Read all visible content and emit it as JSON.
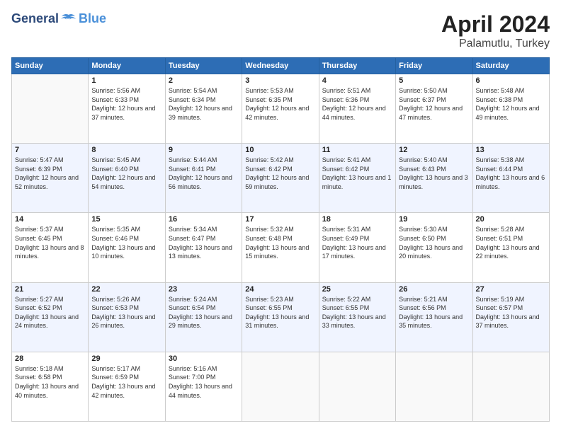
{
  "logo": {
    "general": "General",
    "blue": "Blue"
  },
  "title": {
    "month_year": "April 2024",
    "location": "Palamutlu, Turkey"
  },
  "weekdays": [
    "Sunday",
    "Monday",
    "Tuesday",
    "Wednesday",
    "Thursday",
    "Friday",
    "Saturday"
  ],
  "weeks": [
    [
      {
        "day": "",
        "sunrise": "",
        "sunset": "",
        "daylight": ""
      },
      {
        "day": "1",
        "sunrise": "Sunrise: 5:56 AM",
        "sunset": "Sunset: 6:33 PM",
        "daylight": "Daylight: 12 hours and 37 minutes."
      },
      {
        "day": "2",
        "sunrise": "Sunrise: 5:54 AM",
        "sunset": "Sunset: 6:34 PM",
        "daylight": "Daylight: 12 hours and 39 minutes."
      },
      {
        "day": "3",
        "sunrise": "Sunrise: 5:53 AM",
        "sunset": "Sunset: 6:35 PM",
        "daylight": "Daylight: 12 hours and 42 minutes."
      },
      {
        "day": "4",
        "sunrise": "Sunrise: 5:51 AM",
        "sunset": "Sunset: 6:36 PM",
        "daylight": "Daylight: 12 hours and 44 minutes."
      },
      {
        "day": "5",
        "sunrise": "Sunrise: 5:50 AM",
        "sunset": "Sunset: 6:37 PM",
        "daylight": "Daylight: 12 hours and 47 minutes."
      },
      {
        "day": "6",
        "sunrise": "Sunrise: 5:48 AM",
        "sunset": "Sunset: 6:38 PM",
        "daylight": "Daylight: 12 hours and 49 minutes."
      }
    ],
    [
      {
        "day": "7",
        "sunrise": "Sunrise: 5:47 AM",
        "sunset": "Sunset: 6:39 PM",
        "daylight": "Daylight: 12 hours and 52 minutes."
      },
      {
        "day": "8",
        "sunrise": "Sunrise: 5:45 AM",
        "sunset": "Sunset: 6:40 PM",
        "daylight": "Daylight: 12 hours and 54 minutes."
      },
      {
        "day": "9",
        "sunrise": "Sunrise: 5:44 AM",
        "sunset": "Sunset: 6:41 PM",
        "daylight": "Daylight: 12 hours and 56 minutes."
      },
      {
        "day": "10",
        "sunrise": "Sunrise: 5:42 AM",
        "sunset": "Sunset: 6:42 PM",
        "daylight": "Daylight: 12 hours and 59 minutes."
      },
      {
        "day": "11",
        "sunrise": "Sunrise: 5:41 AM",
        "sunset": "Sunset: 6:42 PM",
        "daylight": "Daylight: 13 hours and 1 minute."
      },
      {
        "day": "12",
        "sunrise": "Sunrise: 5:40 AM",
        "sunset": "Sunset: 6:43 PM",
        "daylight": "Daylight: 13 hours and 3 minutes."
      },
      {
        "day": "13",
        "sunrise": "Sunrise: 5:38 AM",
        "sunset": "Sunset: 6:44 PM",
        "daylight": "Daylight: 13 hours and 6 minutes."
      }
    ],
    [
      {
        "day": "14",
        "sunrise": "Sunrise: 5:37 AM",
        "sunset": "Sunset: 6:45 PM",
        "daylight": "Daylight: 13 hours and 8 minutes."
      },
      {
        "day": "15",
        "sunrise": "Sunrise: 5:35 AM",
        "sunset": "Sunset: 6:46 PM",
        "daylight": "Daylight: 13 hours and 10 minutes."
      },
      {
        "day": "16",
        "sunrise": "Sunrise: 5:34 AM",
        "sunset": "Sunset: 6:47 PM",
        "daylight": "Daylight: 13 hours and 13 minutes."
      },
      {
        "day": "17",
        "sunrise": "Sunrise: 5:32 AM",
        "sunset": "Sunset: 6:48 PM",
        "daylight": "Daylight: 13 hours and 15 minutes."
      },
      {
        "day": "18",
        "sunrise": "Sunrise: 5:31 AM",
        "sunset": "Sunset: 6:49 PM",
        "daylight": "Daylight: 13 hours and 17 minutes."
      },
      {
        "day": "19",
        "sunrise": "Sunrise: 5:30 AM",
        "sunset": "Sunset: 6:50 PM",
        "daylight": "Daylight: 13 hours and 20 minutes."
      },
      {
        "day": "20",
        "sunrise": "Sunrise: 5:28 AM",
        "sunset": "Sunset: 6:51 PM",
        "daylight": "Daylight: 13 hours and 22 minutes."
      }
    ],
    [
      {
        "day": "21",
        "sunrise": "Sunrise: 5:27 AM",
        "sunset": "Sunset: 6:52 PM",
        "daylight": "Daylight: 13 hours and 24 minutes."
      },
      {
        "day": "22",
        "sunrise": "Sunrise: 5:26 AM",
        "sunset": "Sunset: 6:53 PM",
        "daylight": "Daylight: 13 hours and 26 minutes."
      },
      {
        "day": "23",
        "sunrise": "Sunrise: 5:24 AM",
        "sunset": "Sunset: 6:54 PM",
        "daylight": "Daylight: 13 hours and 29 minutes."
      },
      {
        "day": "24",
        "sunrise": "Sunrise: 5:23 AM",
        "sunset": "Sunset: 6:55 PM",
        "daylight": "Daylight: 13 hours and 31 minutes."
      },
      {
        "day": "25",
        "sunrise": "Sunrise: 5:22 AM",
        "sunset": "Sunset: 6:55 PM",
        "daylight": "Daylight: 13 hours and 33 minutes."
      },
      {
        "day": "26",
        "sunrise": "Sunrise: 5:21 AM",
        "sunset": "Sunset: 6:56 PM",
        "daylight": "Daylight: 13 hours and 35 minutes."
      },
      {
        "day": "27",
        "sunrise": "Sunrise: 5:19 AM",
        "sunset": "Sunset: 6:57 PM",
        "daylight": "Daylight: 13 hours and 37 minutes."
      }
    ],
    [
      {
        "day": "28",
        "sunrise": "Sunrise: 5:18 AM",
        "sunset": "Sunset: 6:58 PM",
        "daylight": "Daylight: 13 hours and 40 minutes."
      },
      {
        "day": "29",
        "sunrise": "Sunrise: 5:17 AM",
        "sunset": "Sunset: 6:59 PM",
        "daylight": "Daylight: 13 hours and 42 minutes."
      },
      {
        "day": "30",
        "sunrise": "Sunrise: 5:16 AM",
        "sunset": "Sunset: 7:00 PM",
        "daylight": "Daylight: 13 hours and 44 minutes."
      },
      {
        "day": "",
        "sunrise": "",
        "sunset": "",
        "daylight": ""
      },
      {
        "day": "",
        "sunrise": "",
        "sunset": "",
        "daylight": ""
      },
      {
        "day": "",
        "sunrise": "",
        "sunset": "",
        "daylight": ""
      },
      {
        "day": "",
        "sunrise": "",
        "sunset": "",
        "daylight": ""
      }
    ]
  ]
}
